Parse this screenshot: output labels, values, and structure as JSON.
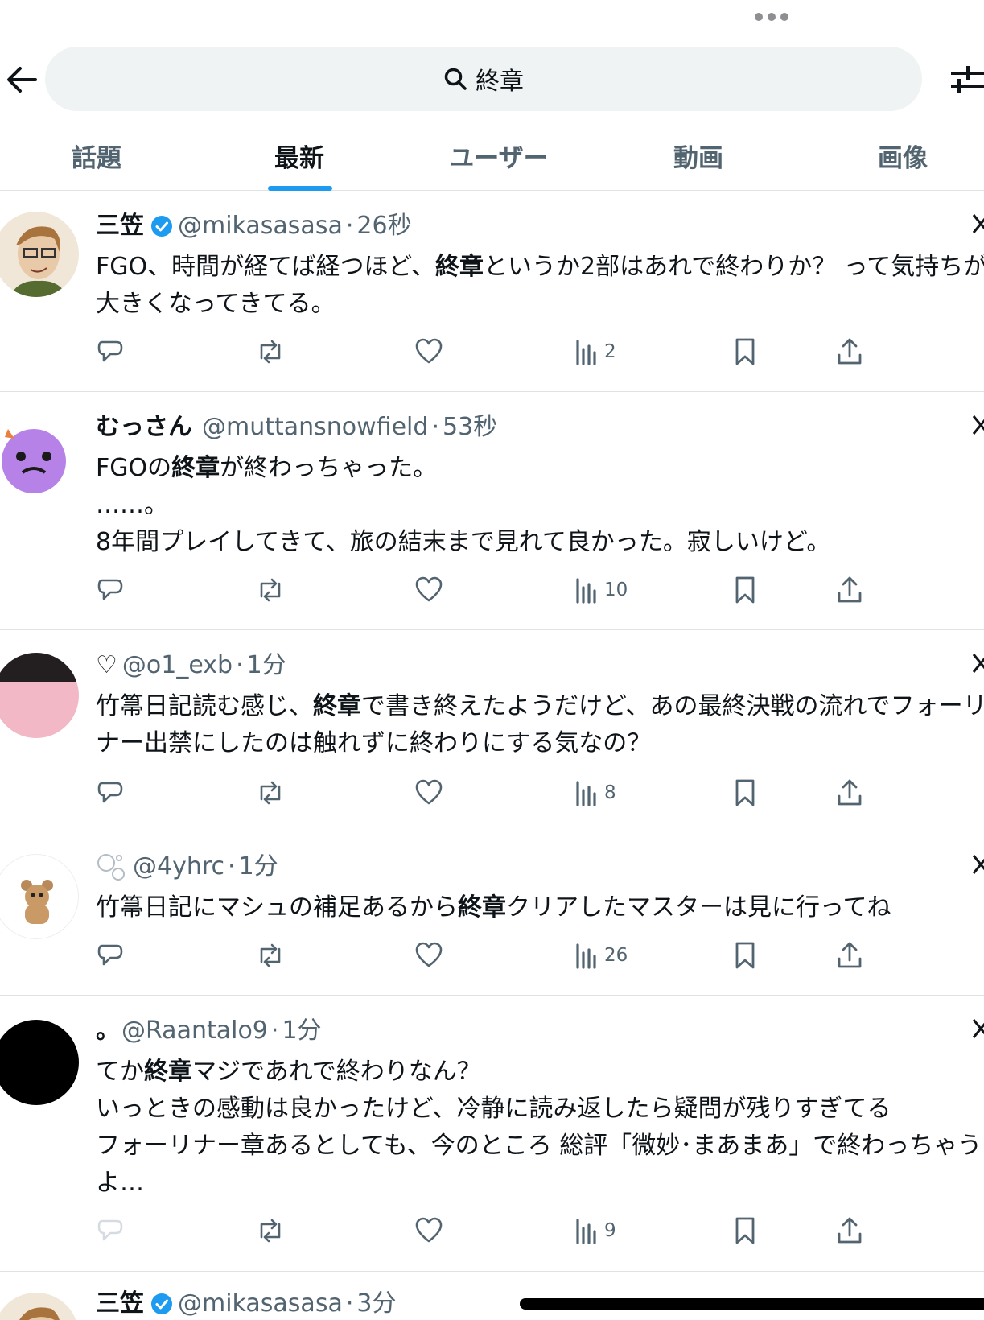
{
  "search": {
    "query": "終章"
  },
  "tabs": [
    {
      "label": "話題",
      "active": false
    },
    {
      "label": "最新",
      "active": true
    },
    {
      "label": "ユーザー",
      "active": false
    },
    {
      "label": "動画",
      "active": false
    },
    {
      "label": "画像",
      "active": false
    }
  ],
  "colors": {
    "accent": "#1d9bf0",
    "text": "#0f1419",
    "muted": "#536471",
    "divider": "#dfe3e6"
  },
  "tweets": [
    {
      "name": "三笠",
      "verified": true,
      "handle": "@mikasasasa",
      "time": "26秒",
      "text": "FGO、時間が経てば経つほど、終章というか2部はあれで終わりか？ って気持ちが大きくなってきてる。",
      "views": "2"
    },
    {
      "name": "むっさん",
      "verified": false,
      "handle": "@muttansnowfield",
      "time": "53秒",
      "text": "FGOの終章が終わっちゃった。\n……。\n8年間プレイしてきて、旅の結末まで見れて良かった。寂しいけど。",
      "views": "10"
    },
    {
      "name": "♡",
      "verified": false,
      "handle": "@o1_exb",
      "time": "1分",
      "text": "竹箒日記読む感じ、終章で書き終えたようだけど、あの最終決戦の流れでフォーリナー出禁にしたのは触れずに終わりにする気なの？",
      "views": "8"
    },
    {
      "name": "",
      "verified": false,
      "handle": "@4yhrc",
      "time": "1分",
      "text": "竹箒日記にマシュの補足あるから終章クリアしたマスターは見に行ってね",
      "views": "26"
    },
    {
      "name": "。",
      "verified": false,
      "handle": "@Raantalo9",
      "time": "1分",
      "text": "てか終章マジであれで終わりなん？\nいっときの感動は良かったけど、冷静に読み返したら疑問が残りすぎてる\nフォーリナー章あるとしても、今のところ 総評「微妙･まあまあ」で終わっちゃうよ…",
      "views": "9"
    },
    {
      "name": "三笠",
      "verified": true,
      "handle": "@mikasasasa",
      "time": "3分",
      "text": "",
      "views": ""
    }
  ],
  "icons": {
    "back": "arrow-left-icon",
    "search": "search-icon",
    "filter": "sliders-icon",
    "reply": "reply-icon",
    "repost": "repost-icon",
    "like": "heart-icon",
    "views": "bar-chart-icon",
    "bookmark": "bookmark-icon",
    "share": "share-icon",
    "verified": "verified-badge-icon"
  }
}
